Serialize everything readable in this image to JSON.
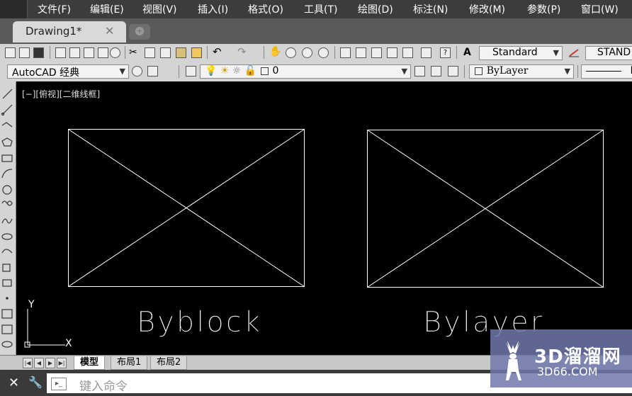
{
  "menu": {
    "items": [
      "文件(F)",
      "编辑(E)",
      "视图(V)",
      "插入(I)",
      "格式(O)",
      "工具(T)",
      "绘图(D)",
      "标注(N)",
      "修改(M)",
      "参数(P)",
      "窗口(W)"
    ]
  },
  "doc_tab": {
    "title": "Drawing1*",
    "close": "✕"
  },
  "toolbar": {
    "text_style": "Standard",
    "dim_style": "STAND",
    "workspace": "AutoCAD 经典",
    "layer": "0",
    "color": "ByLayer",
    "linetype_end": "B"
  },
  "viewport": {
    "label": "[−][俯视][二维线框]"
  },
  "drawing": {
    "text_left": "Byblock",
    "text_right": "Bylayer",
    "ucs_y": "Y",
    "ucs_x": "X",
    "line_color": "#ffffff"
  },
  "layout_tabs": [
    "模型",
    "布局1",
    "布局2"
  ],
  "command": {
    "placeholder": "键入命令"
  },
  "watermark": {
    "text": "3D溜溜网",
    "url": "3D66.COM"
  }
}
